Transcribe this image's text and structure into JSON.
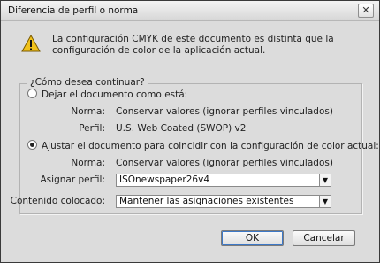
{
  "window": {
    "title": "Diferencia de perfil o norma",
    "close_glyph": "✕"
  },
  "icons": {
    "warning": "warning-icon",
    "close": "close-icon",
    "dropdown": "chevron-down-icon"
  },
  "colors": {
    "warning_yellow": "#f1c21b",
    "accent": "#3d78c6"
  },
  "message": "La configuración CMYK de este documento es distinta que la configuración de color de la aplicación actual.",
  "group": {
    "legend": "¿Cómo desea continuar?",
    "option_keep": {
      "label": "Dejar el documento como está:",
      "selected": false,
      "norma_label": "Norma:",
      "norma_value": "Conservar valores (ignorar perfiles vinculados)",
      "perfil_label": "Perfil:",
      "perfil_value": "U.S. Web Coated (SWOP) v2"
    },
    "option_adjust": {
      "label": "Ajustar el documento para coincidir con la configuración de color actual:",
      "selected": true,
      "norma_label": "Norma:",
      "norma_value": "Conservar valores (ignorar perfiles vinculados)",
      "assign_label": "Asignar perfil:",
      "assign_value": "ISOnewspaper26v4",
      "placed_label": "Contenido colocado:",
      "placed_value": "Mantener las asignaciones existentes"
    }
  },
  "buttons": {
    "ok": "OK",
    "cancel": "Cancelar"
  }
}
